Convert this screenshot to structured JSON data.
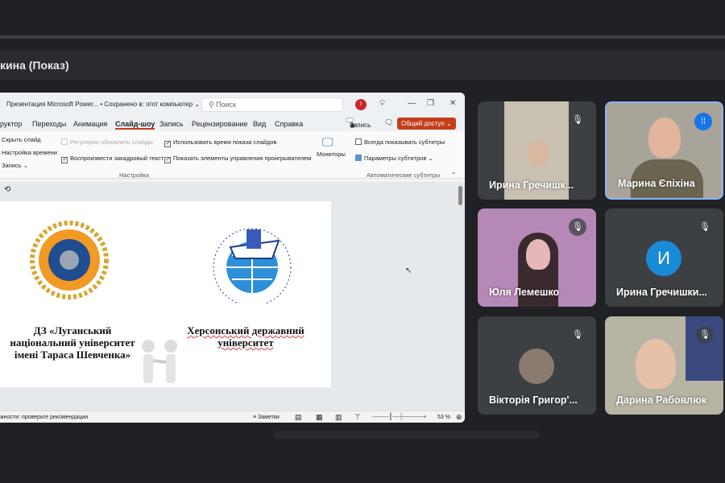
{
  "meet": {
    "presentation_title": "кина (Показ)"
  },
  "ppt": {
    "title": "Презентация Microsoft Power... • Сохранено в: этот компьютер ⌄",
    "search_placeholder": "Поиск",
    "user_initial": "I",
    "tabs": [
      "руктор",
      "Переходы",
      "Анимация",
      "Слайд-шоу",
      "Запись",
      "Рецензирование",
      "Вид",
      "Справка"
    ],
    "active_tab": "Слайд-шоу",
    "record_button": "Запись",
    "share_button": "Общий доступ ⌄",
    "ribbon": {
      "hide_slide": "Скрыть слайд",
      "timing": "Настройка времени",
      "record": "Запись  ⌄",
      "auto_update": "Регулярно обновлять слайды",
      "play_narration": "Воспроизвести закадровый текст",
      "use_timings": "Использовать время показа слайдов",
      "show_controls": "Показать элементы управления проигрывателем",
      "monitors": "Мониторы",
      "group_setup": "Настройка",
      "always_subtitles": "Всегда показывать субтитры",
      "subtitle_settings": "Параметры субтитров ⌄",
      "group_subtitles": "Автоматические субтитры"
    },
    "slide": {
      "left_text": "ДЗ «Луганський національний університет імені Тараса Шевченка»",
      "right_text": "Херсонський державний університет",
      "logo_text": "ХЕРСОНСЬКИЙ ДЕРЖАВНИЙ УНІВЕРСИТЕТ · KHERSON STATE UNIVERSITY"
    },
    "status": {
      "accessibility": "жности: проверьте рекомендации",
      "notes": "Заметки",
      "zoom": "53 %"
    }
  },
  "participants": [
    {
      "name": "Ирина Гречишк...",
      "muted": true,
      "bg": "#b9b3a5"
    },
    {
      "name": "Марина Єпіхіна",
      "muted": false,
      "speaking": true,
      "bg": "#a9a49a"
    },
    {
      "name": "Юля Лемешко",
      "muted": true,
      "bg": "#b688b6"
    },
    {
      "name": "Ирина Гречишки...",
      "muted": true,
      "initial": "И",
      "bg": "#3c4043"
    },
    {
      "name": "Вікторія Григор'...",
      "muted": true,
      "bg": "#3c4043"
    },
    {
      "name": "Дарина Рабовлюк",
      "muted": true,
      "bg": "#b8b4a4"
    }
  ],
  "colors": {
    "accent": "#8ab4f8",
    "avatar": "#1a8bd6",
    "ppt_accent": "#c43e1c"
  }
}
